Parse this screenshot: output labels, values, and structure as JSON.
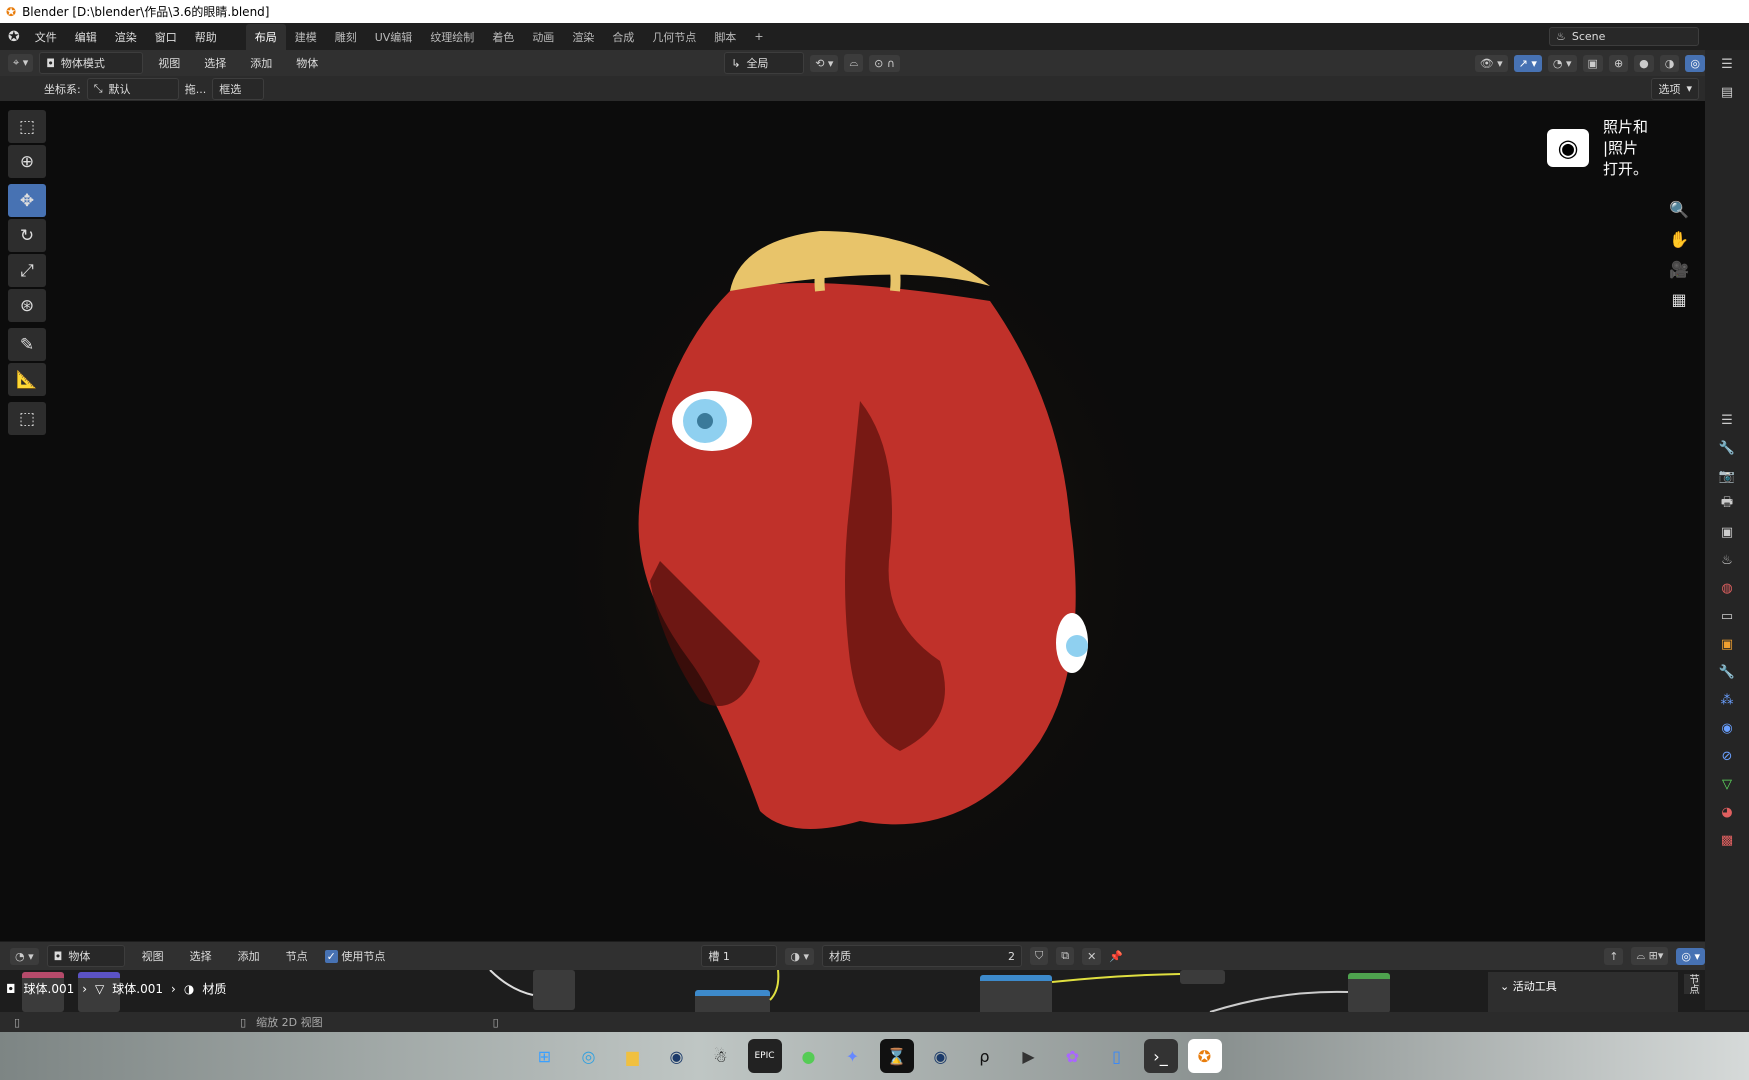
{
  "window": {
    "title": "Blender [D:\\blender\\作品\\3.6的眼睛.blend]"
  },
  "topbar": {
    "menus": [
      "文件",
      "编辑",
      "渲染",
      "窗口",
      "帮助"
    ],
    "workspaces": [
      "布局",
      "建模",
      "雕刻",
      "UV编辑",
      "纹理绘制",
      "着色",
      "动画",
      "渲染",
      "合成",
      "几何节点",
      "脚本"
    ],
    "active_workspace": "布局",
    "add": "+",
    "scene": "Scene"
  },
  "header": {
    "mode": "物体模式",
    "menus": [
      "视图",
      "选择",
      "添加",
      "物体"
    ],
    "orientation": "全局"
  },
  "tool_settings": {
    "coord_label": "坐标系:",
    "coord_value": "默认",
    "drag": "拖...",
    "select": "框选",
    "options": "选项"
  },
  "toolbar": {
    "tools": [
      {
        "name": "select-box",
        "glyph": "⬚"
      },
      {
        "name": "cursor",
        "glyph": "⊕"
      },
      {
        "name": "move",
        "glyph": "✥"
      },
      {
        "name": "rotate",
        "glyph": "↻"
      },
      {
        "name": "scale",
        "glyph": "⤢"
      },
      {
        "name": "transform",
        "glyph": "⊛"
      },
      {
        "name": "annotate",
        "glyph": "✎"
      },
      {
        "name": "measure",
        "glyph": "📐"
      },
      {
        "name": "add-cube",
        "glyph": "⬚"
      }
    ],
    "active": "move"
  },
  "notification": {
    "lines": [
      "照片和",
      "|照片",
      "打开。"
    ]
  },
  "node_editor": {
    "editor_type": "物体",
    "menus": [
      "视图",
      "选择",
      "添加",
      "节点"
    ],
    "use_nodes": "使用节点",
    "slot": "槽 1",
    "material": "材质",
    "users": "2",
    "breadcrumb": [
      "球体.001",
      "球体.001",
      "材质"
    ],
    "sidebar_title": "活动工具",
    "sidebar_tab": "节点"
  },
  "status": {
    "hint": "缩放 2D 视图"
  },
  "colors": {
    "accent": "#4772b3",
    "ornament_red": "#c0312a",
    "gold": "#e8c46a",
    "eye": "#8fd0f0"
  }
}
